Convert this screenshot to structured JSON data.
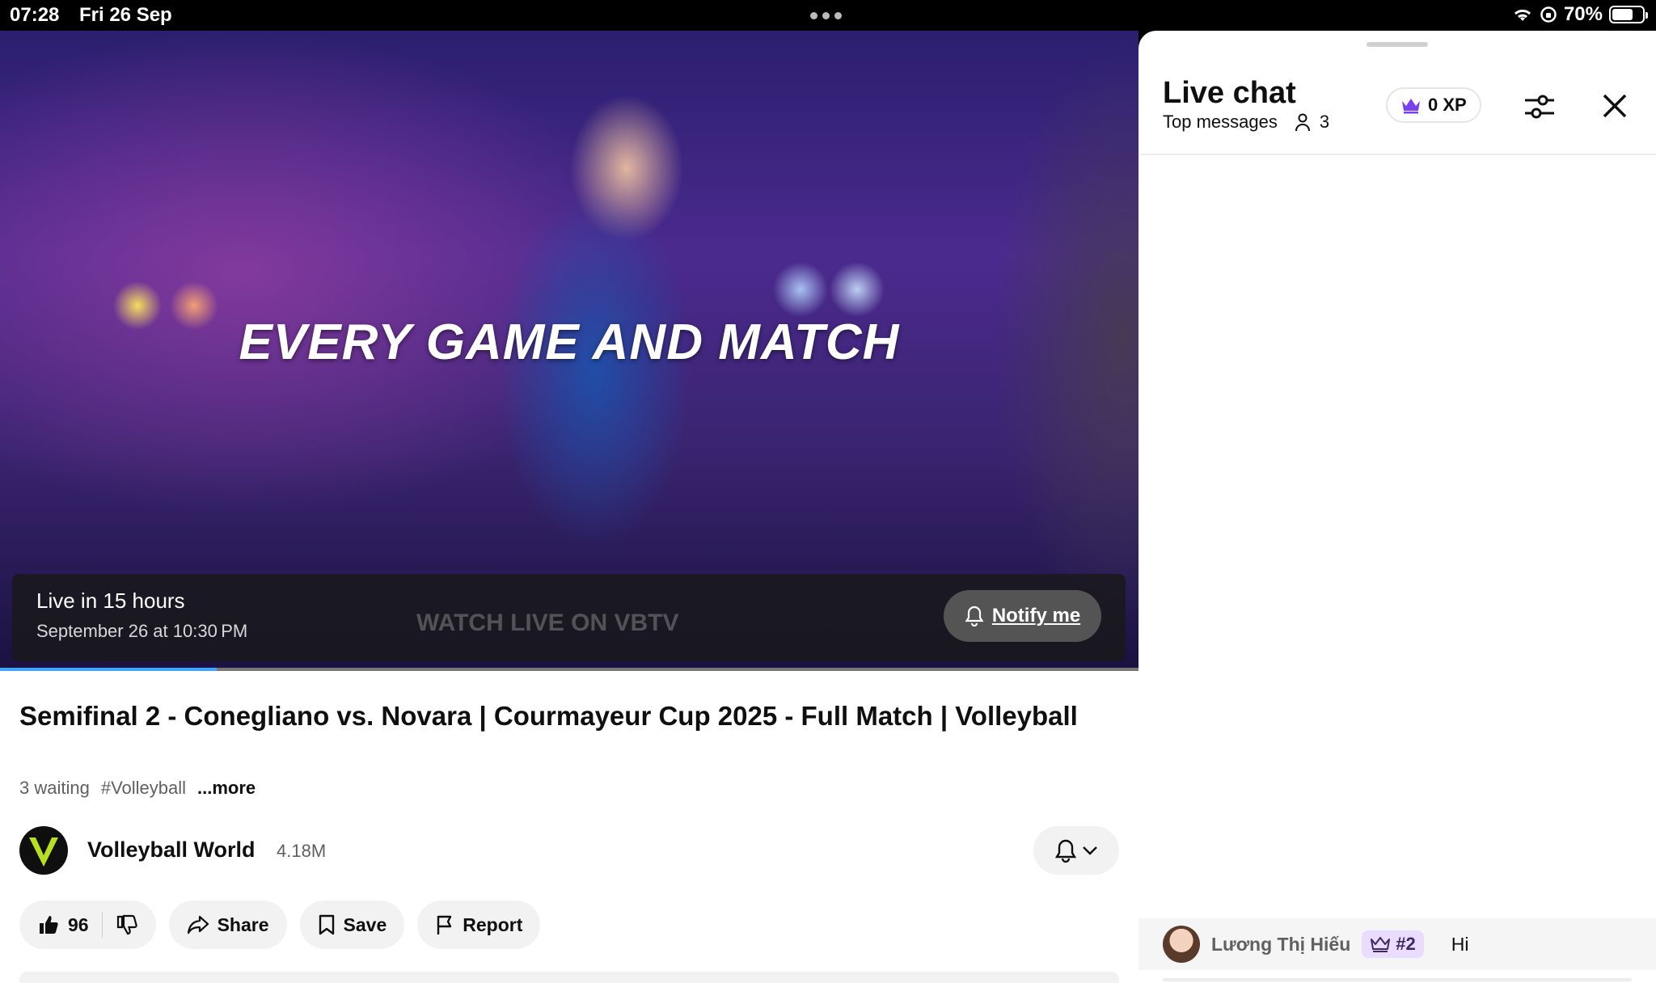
{
  "status_bar": {
    "time": "07:28",
    "date": "Fri 26 Sep",
    "battery": "70%"
  },
  "video": {
    "overlay_text": "EVERY GAME AND MATCH",
    "watermark": "WATCH LIVE ON  VBTV",
    "live_status": "Live in 15 hours",
    "live_time": "September 26 at 10:30 PM",
    "notify_label": "Notify me",
    "progress_fraction": 0.19
  },
  "details": {
    "title": "Semifinal 2 - Conegliano vs. Novara | Courmayeur Cup 2025 - Full Match | Volleyball",
    "waiting": "3 waiting",
    "hashtag": "#Volleyball",
    "more": "...more",
    "channel_name": "Volleyball World",
    "subscribers": "4.18M",
    "likes": "96",
    "share": "Share",
    "save": "Save",
    "report": "Report"
  },
  "chat": {
    "title": "Live chat",
    "mode": "Top messages",
    "viewers": "3",
    "xp": "0 XP",
    "messages": [
      {
        "author": "Lương Thị Hiếu",
        "rank": "#2",
        "text": "Hi"
      }
    ]
  },
  "colors": {
    "accent": "#3ea6ff",
    "crown": "#7b3ff2",
    "text": "#0f0f0f",
    "secondary": "#606060",
    "channel_logo": "#b7e11f"
  }
}
